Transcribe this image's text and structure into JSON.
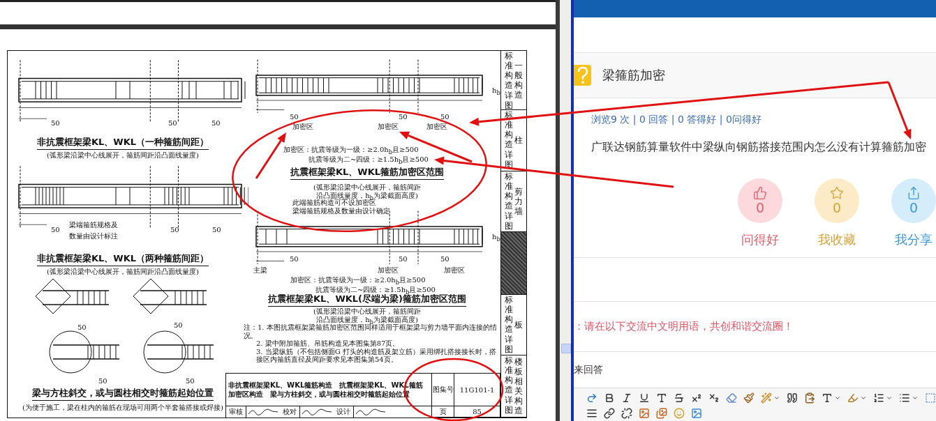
{
  "document": {
    "left_drawings": [
      {
        "title": "非抗震框架梁KL、WKL（一种箍筋间距）",
        "subtitle": "(弧形梁沿梁中心线展开，箍筋间距沿凸面线量度)"
      },
      {
        "title": "非抗震框架梁KL、WKL（两种箍筋间距）",
        "subtitle": "(弧形梁沿梁中心线展开，箍筋间距沿凸面线量度)"
      },
      {
        "title": "梁与方柱斜交，或与圆柱相交时箍筋起始位置",
        "subtitle": "(为便于施工，梁在柱内的箍筋在现场可用两个半套箍搭接或焊接)"
      }
    ],
    "left_note": [
      "梁端箍筋规格及",
      "数量由设计标注"
    ],
    "right_drawings": [
      {
        "zone_labels": [
          "加密区",
          "加密区",
          "加密区"
        ],
        "formula": [
          "加密区：抗震等级为一级：≥2.0h$_{b}$且≥500",
          "抗震等级为二~四级：≥1.5h$_{b}$且≥500"
        ],
        "title": "抗震框架梁KL、WKL箍筋加密区范围",
        "subtitle": [
          "(弧形梁沿梁中心线展开，箍筋间距",
          "沿凸面线量度，h$_{b}$为梁截面高度)"
        ]
      },
      {
        "zone_labels": [
          "加密区",
          "加密区"
        ],
        "formula": [
          "加密区：抗震等级为一级：≥2.0h$_{b}$且≥500",
          "抗震等级为二~四级：≥1.5h$_{b}$且≥500"
        ],
        "title": "抗震框架梁KL、WKL(尽端为梁)箍筋加密区范围",
        "subtitle": [
          "(弧形梁沿梁中心线展开，箍筋间距",
          "沿凸面线量度，h$_{b}$为梁截面高度)"
        ]
      }
    ],
    "end_note": [
      "此端箍筋构造可不设加密区",
      "梁端箍筋规格及数量由设计确定"
    ],
    "main_beam_label": "主梁",
    "height_labels": [
      "h$_{b}$",
      "h$_{b}$"
    ],
    "dimension_labels": [
      "50",
      "50",
      "50",
      "50",
      "50",
      "50",
      "50",
      "50",
      "50",
      "50",
      "50",
      "50",
      "50",
      "50",
      "50",
      "50"
    ],
    "notes": [
      "注：1. 本图抗震框架梁箍筋加密区范围同样适用于框架梁与剪力墙平面内连接的情况。",
      "2. 梁中附加箍筋、吊筋构造见本图集第87页。",
      "3. 当梁纵筋（不包括侧面G 打头的构造筋及架立筋）采用绑扎搭接接长时，搭接区内箍筋直径及间距要求见本图集第54页。"
    ],
    "title_block": {
      "title": [
        "非抗震框架梁KL、WKL箍筋构造　抗震框架梁KL、WKL箍筋",
        "加密区构造　梁与方柱斜交，或与圆柱相交时箍筋起始位置"
      ],
      "atlas_label": "图集号",
      "atlas_number": "11G101-1",
      "page_label": "页",
      "page_number": "85",
      "roles": [
        "审核",
        "校对",
        "设计"
      ]
    },
    "side_tabs": [
      {
        "kind": "label",
        "series": "标准构造详图",
        "category": "一般构造"
      },
      {
        "kind": "label",
        "series": "标准构造详图",
        "category": "柱"
      },
      {
        "kind": "label",
        "series": "标准构造详图",
        "category": "剪力墙"
      },
      {
        "kind": "shaded"
      },
      {
        "kind": "label",
        "series": "标准构造详图",
        "category": "板"
      },
      {
        "kind": "label",
        "series": "标准构造详图",
        "category": "楼板相关构造"
      }
    ]
  },
  "question": {
    "title": "梁箍筋加密",
    "stats": "浏览9 次 | 0 回答 | 0 答得好 | 0问得好",
    "body": "广联达钢筋算量软件中梁纵向钢筋搭接范围内怎么没有计算箍筋加密",
    "actions": [
      {
        "kind": "like",
        "count": "0",
        "label": "问得好"
      },
      {
        "kind": "favorite",
        "count": "0",
        "label": "我收藏"
      },
      {
        "kind": "share",
        "count": "0",
        "label": "我分享"
      }
    ]
  },
  "notice": "：请在以下交流中文明用语，共创和谐交流圈！",
  "answer_label": "来回答"
}
